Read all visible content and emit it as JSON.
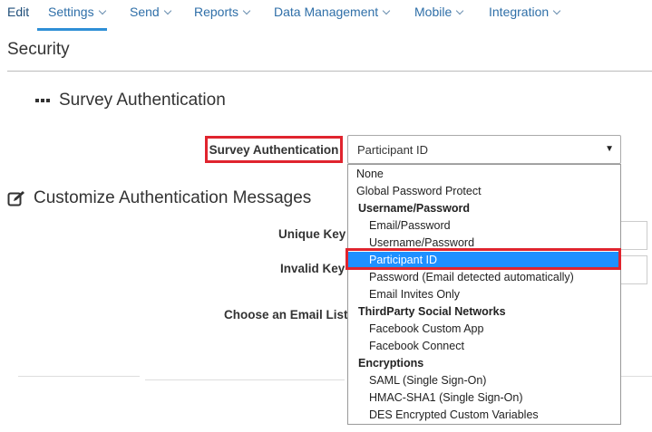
{
  "nav": {
    "edit": "Edit",
    "settings": "Settings",
    "send": "Send",
    "reports": "Reports",
    "data_management": "Data Management",
    "mobile": "Mobile",
    "integration": "Integration"
  },
  "page": {
    "title": "Security"
  },
  "survey_auth": {
    "section_title": "Survey Authentication",
    "field_label": "Survey Authentication",
    "selected_value": "Participant ID"
  },
  "customize": {
    "title": "Customize Authentication Messages",
    "unique_key_label": "Unique Key",
    "invalid_key_label": "Invalid Key",
    "email_list_label": "Choose an Email List"
  },
  "dropdown": {
    "options": [
      {
        "label": "None",
        "kind": "top"
      },
      {
        "label": "Global Password Protect",
        "kind": "top"
      },
      {
        "label": "Username/Password",
        "kind": "group"
      },
      {
        "label": "Email/Password",
        "kind": "sub"
      },
      {
        "label": "Username/Password",
        "kind": "sub"
      },
      {
        "label": "Participant ID",
        "kind": "sub",
        "selected": true
      },
      {
        "label": "Password (Email detected automatically)",
        "kind": "sub"
      },
      {
        "label": "Email Invites Only",
        "kind": "sub"
      },
      {
        "label": "ThirdParty Social Networks",
        "kind": "group"
      },
      {
        "label": "Facebook Custom App",
        "kind": "sub"
      },
      {
        "label": "Facebook Connect",
        "kind": "sub"
      },
      {
        "label": "Encryptions",
        "kind": "group"
      },
      {
        "label": "SAML (Single Sign-On)",
        "kind": "sub"
      },
      {
        "label": "HMAC-SHA1 (Single Sign-On)",
        "kind": "sub"
      },
      {
        "label": "DES Encrypted Custom Variables",
        "kind": "sub"
      }
    ]
  },
  "colors": {
    "accent": "#2f8fd6",
    "highlight": "#e0242e",
    "selected_bg": "#1e90ff",
    "nav_link": "#2f6fa8"
  },
  "icons": {
    "section": "dots-icon",
    "customize": "edit-icon",
    "select": "caret-down-icon"
  }
}
